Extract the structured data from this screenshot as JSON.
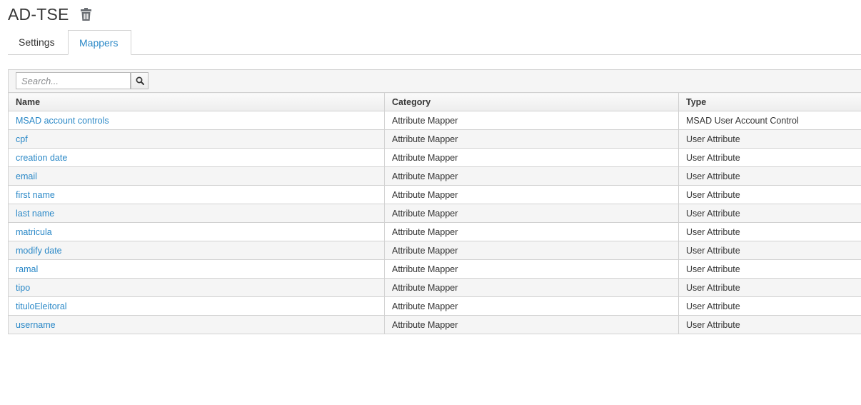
{
  "header": {
    "title": "AD-TSE",
    "delete_icon": "trash-icon"
  },
  "tabs": [
    {
      "label": "Settings",
      "active": false
    },
    {
      "label": "Mappers",
      "active": true
    }
  ],
  "search": {
    "placeholder": "Search...",
    "value": "",
    "icon": "search-icon"
  },
  "table": {
    "columns": [
      "Name",
      "Category",
      "Type"
    ],
    "rows": [
      {
        "name": "MSAD account controls",
        "category": "Attribute Mapper",
        "type": "MSAD User Account Control"
      },
      {
        "name": "cpf",
        "category": "Attribute Mapper",
        "type": "User Attribute"
      },
      {
        "name": "creation date",
        "category": "Attribute Mapper",
        "type": "User Attribute"
      },
      {
        "name": "email",
        "category": "Attribute Mapper",
        "type": "User Attribute"
      },
      {
        "name": "first name",
        "category": "Attribute Mapper",
        "type": "User Attribute"
      },
      {
        "name": "last name",
        "category": "Attribute Mapper",
        "type": "User Attribute"
      },
      {
        "name": "matricula",
        "category": "Attribute Mapper",
        "type": "User Attribute"
      },
      {
        "name": "modify date",
        "category": "Attribute Mapper",
        "type": "User Attribute"
      },
      {
        "name": "ramal",
        "category": "Attribute Mapper",
        "type": "User Attribute"
      },
      {
        "name": "tipo",
        "category": "Attribute Mapper",
        "type": "User Attribute"
      },
      {
        "name": "tituloEleitoral",
        "category": "Attribute Mapper",
        "type": "User Attribute"
      },
      {
        "name": "username",
        "category": "Attribute Mapper",
        "type": "User Attribute"
      }
    ]
  },
  "colors": {
    "link": "#2a88c7",
    "text": "#363636",
    "border": "#d1d1d1",
    "stripe": "#f5f5f5"
  }
}
